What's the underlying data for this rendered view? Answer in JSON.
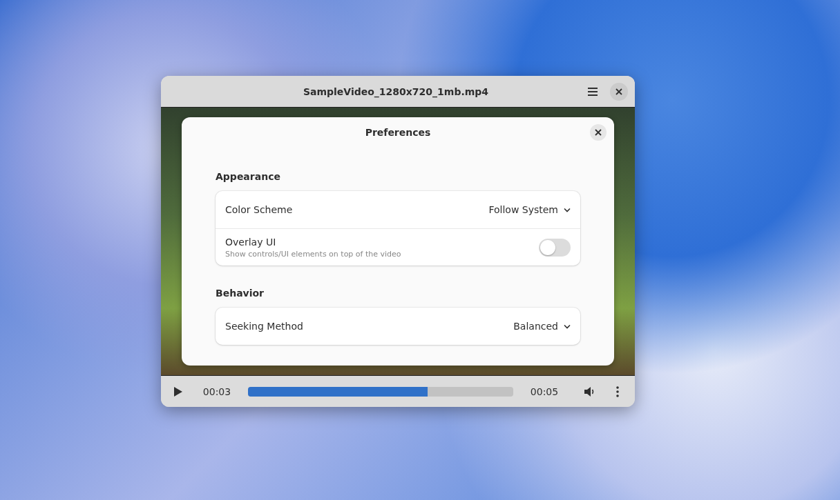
{
  "window": {
    "title": "SampleVideo_1280x720_1mb.mp4"
  },
  "preferences": {
    "title": "Preferences",
    "groups": [
      {
        "title": "Appearance",
        "rows": [
          {
            "kind": "combo",
            "label": "Color Scheme",
            "value": "Follow System"
          },
          {
            "kind": "switch",
            "label": "Overlay UI",
            "subtitle": "Show controls/UI elements on top of the video",
            "on": false
          }
        ]
      },
      {
        "title": "Behavior",
        "rows": [
          {
            "kind": "combo",
            "label": "Seeking Method",
            "value": "Balanced"
          }
        ]
      }
    ]
  },
  "player": {
    "position": "00:03",
    "duration": "00:05",
    "level": 0.676
  }
}
